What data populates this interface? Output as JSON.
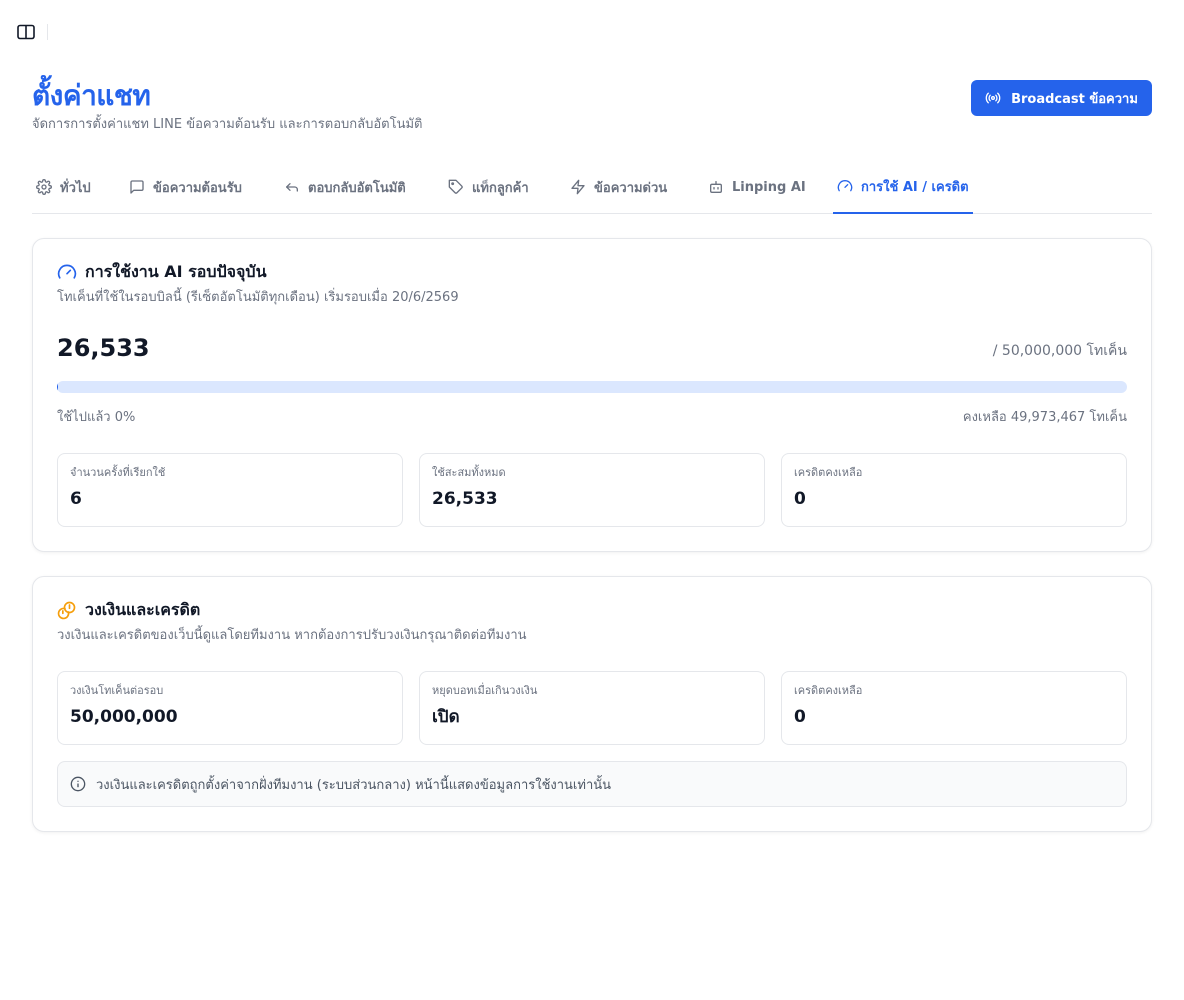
{
  "header": {
    "title": "ตั้งค่าแชท",
    "subtitle": "จัดการการตั้งค่าแชท LINE ข้อความต้อนรับ และการตอบกลับอัตโนมัติ",
    "broadcast_label": "Broadcast ข้อความ"
  },
  "tabs": [
    {
      "label": "ทั่วไป",
      "icon": "gear-icon"
    },
    {
      "label": "ข้อความต้อนรับ",
      "icon": "message-square-icon"
    },
    {
      "label": "ตอบกลับอัตโนมัติ",
      "icon": "reply-icon"
    },
    {
      "label": "แท็กลูกค้า",
      "icon": "tag-icon"
    },
    {
      "label": "ข้อความด่วน",
      "icon": "zap-icon"
    },
    {
      "label": "Linping AI",
      "icon": "bot-icon"
    },
    {
      "label": "การใช้ AI / เครดิต",
      "icon": "gauge-icon",
      "active": true
    }
  ],
  "usage": {
    "title": "การใช้งาน AI รอบปัจจุบัน",
    "description": "โทเค็นที่ใช้ในรอบบิลนี้ (รีเซ็ตอัตโนมัติทุกเดือน) เริ่มรอบเมื่อ 20/6/2569",
    "used_tokens": "26,533",
    "limit_text": "/ 50,000,000 โทเค็น",
    "progress_fraction": 0.00053,
    "used_percent_text": "ใช้ไปแล้ว 0%",
    "remaining_text": "คงเหลือ 49,973,467 โทเค็น",
    "stats": [
      {
        "label": "จำนวนครั้งที่เรียกใช้",
        "value": "6"
      },
      {
        "label": "ใช้สะสมทั้งหมด",
        "value": "26,533"
      },
      {
        "label": "เครดิตคงเหลือ",
        "value": "0"
      }
    ]
  },
  "credit": {
    "title": "วงเงินและเครดิต",
    "description": "วงเงินและเครดิตของเว็บนี้ดูแลโดยทีมงาน หากต้องการปรับวงเงินกรุณาติดต่อทีมงาน",
    "stats": [
      {
        "label": "วงเงินโทเค็นต่อรอบ",
        "value": "50,000,000"
      },
      {
        "label": "หยุดบอทเมื่อเกินวงเงิน",
        "value": "เปิด"
      },
      {
        "label": "เครดิตคงเหลือ",
        "value": "0"
      }
    ],
    "info_text": "วงเงินและเครดิตถูกตั้งค่าจากฝั่งทีมงาน (ระบบส่วนกลาง) หน้านี้แสดงข้อมูลการใช้งานเท่านั้น"
  },
  "colors": {
    "primary": "#2563eb",
    "progress_track": "#dbe7fe",
    "coins_icon": "#f59e0b"
  }
}
